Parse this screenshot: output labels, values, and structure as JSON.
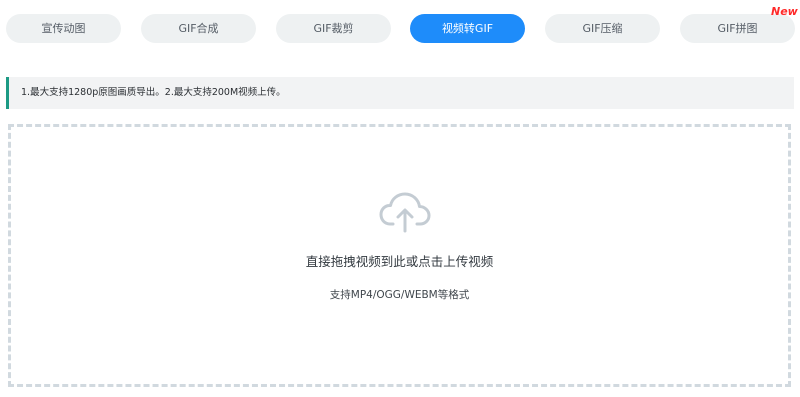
{
  "tabs": [
    {
      "label": "宣传动图",
      "active": false
    },
    {
      "label": "GIF合成",
      "active": false
    },
    {
      "label": "GIF裁剪",
      "active": false
    },
    {
      "label": "视频转GIF",
      "active": true
    },
    {
      "label": "GIF压缩",
      "active": false
    },
    {
      "label": "GIF拼图",
      "active": false
    }
  ],
  "badge": {
    "label": "New"
  },
  "notice": {
    "text": "1.最大支持1280p原图画质导出。2.最大支持200M视频上传。"
  },
  "upload": {
    "icon": "cloud-upload-icon",
    "title": "直接拖拽视频到此或点击上传视频",
    "subtitle": "支持MP4/OGG/WEBM等格式"
  },
  "colors": {
    "accent": "#1e8cfa",
    "notice_border": "#1c9a84",
    "badge": "#ff2a2a",
    "dashed_border": "#d1d9df",
    "tab_bg": "#eef1f2"
  }
}
